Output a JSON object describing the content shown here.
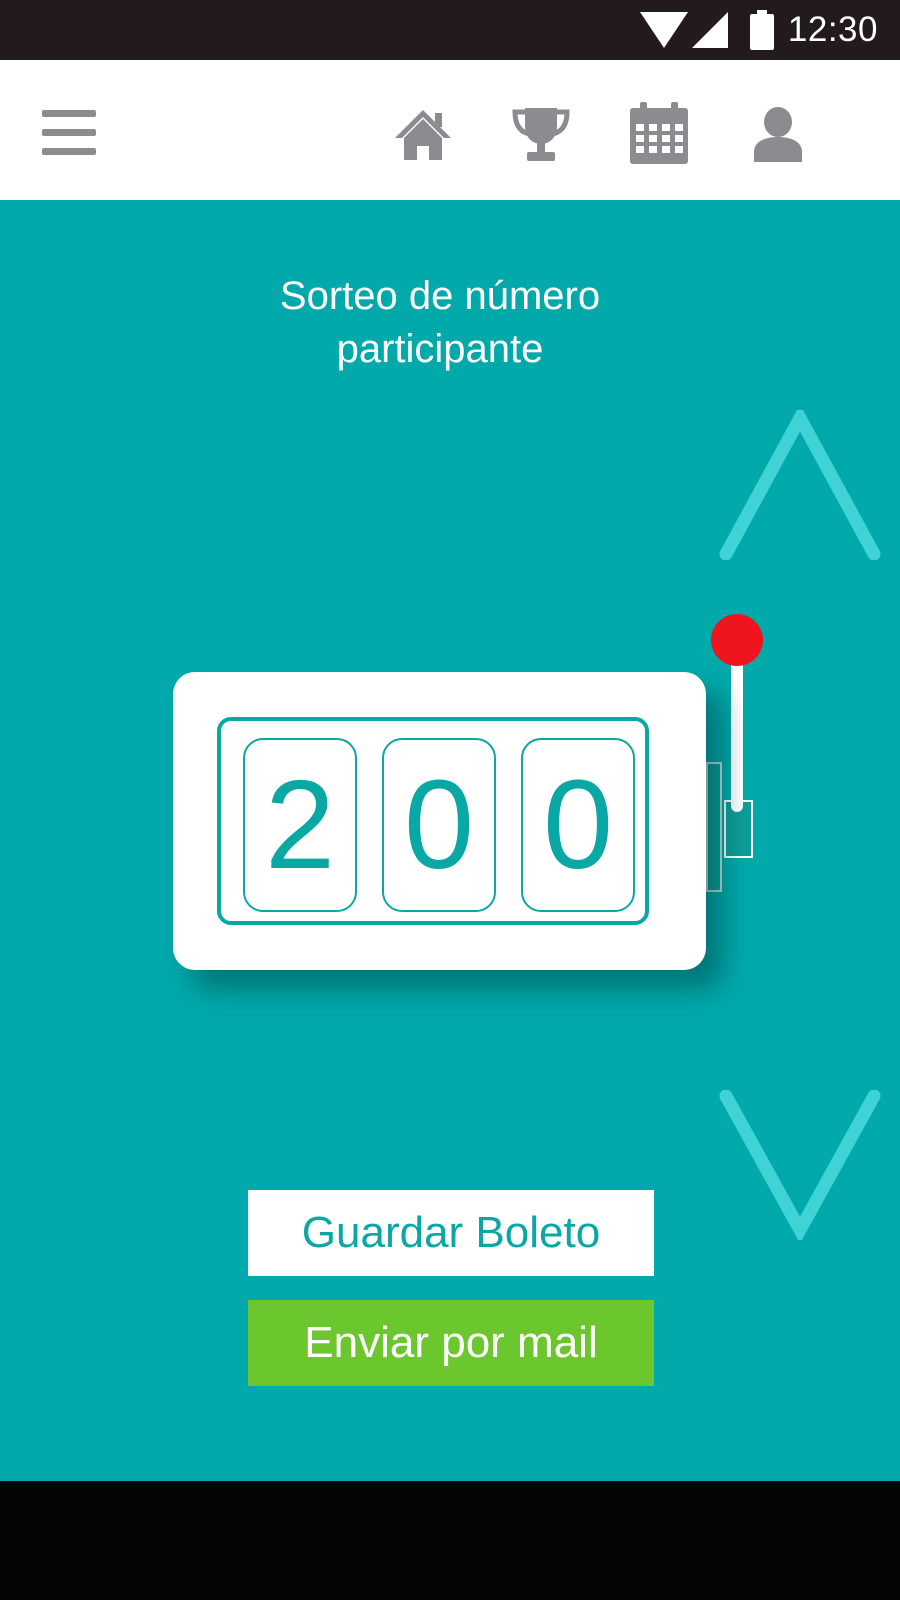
{
  "status_bar": {
    "time": "12:30",
    "icons": [
      "wifi-icon",
      "cell-signal-icon",
      "battery-icon"
    ]
  },
  "app_bar": {
    "menu_icon": "hamburger-menu-icon",
    "nav_icons": [
      "home-icon",
      "trophy-icon",
      "calendar-icon",
      "user-icon"
    ]
  },
  "main": {
    "title_line1": "Sorteo de número",
    "title_line2": "participante",
    "reels": [
      "2",
      "0",
      "0"
    ],
    "up_arrow_icon": "chevron-up-icon",
    "down_arrow_icon": "chevron-down-icon",
    "lever_icon": "slot-lever-icon",
    "save_button_label": "Guardar Boleto",
    "mail_button_label": "Enviar por mail"
  },
  "colors": {
    "status_bar": "#231a1e",
    "background": "#01a9ab",
    "accent_teal": "#0aa8a4",
    "arrow": "#3fd3d6",
    "nav_icon_gray": "#8a8c8f",
    "lever_knob": "#f0141e",
    "mail_button": "#6cc62e"
  }
}
